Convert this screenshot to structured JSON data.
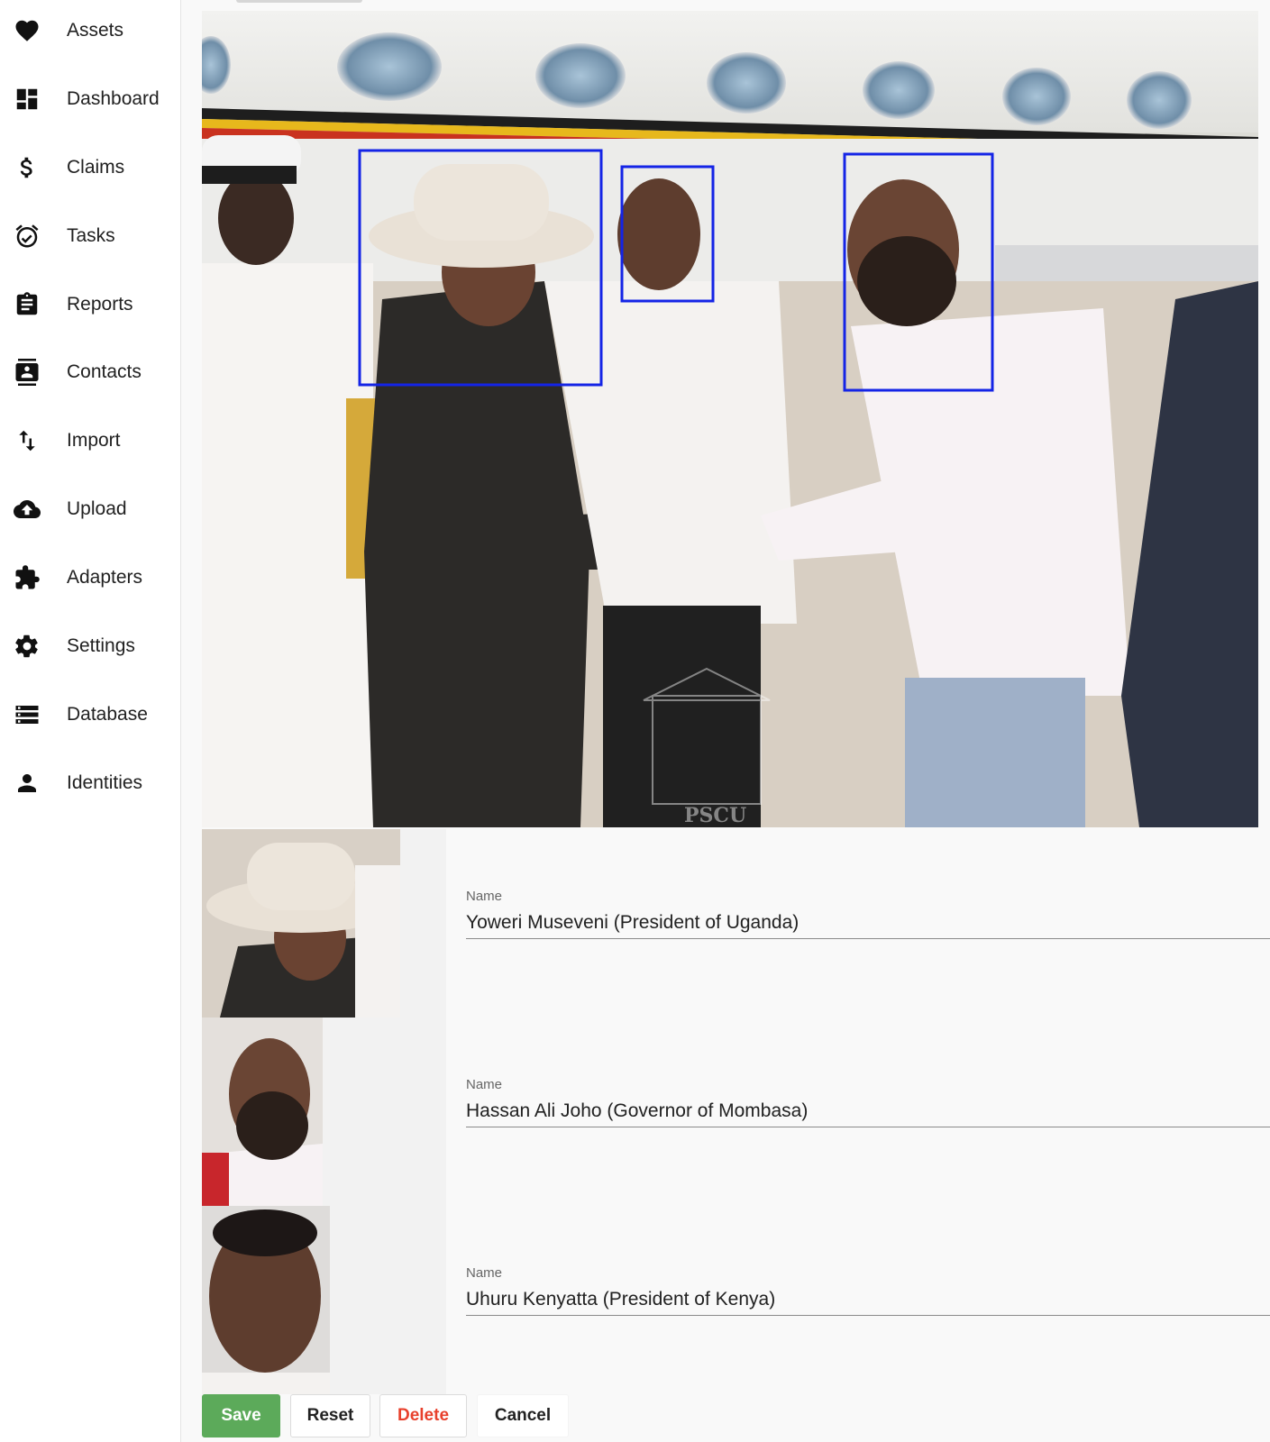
{
  "sidebar": {
    "items": [
      {
        "label": "Assets",
        "icon": "heart-icon"
      },
      {
        "label": "Dashboard",
        "icon": "dashboard-icon"
      },
      {
        "label": "Claims",
        "icon": "dollar-icon"
      },
      {
        "label": "Tasks",
        "icon": "alarm-clock-icon"
      },
      {
        "label": "Reports",
        "icon": "clipboard-icon"
      },
      {
        "label": "Contacts",
        "icon": "contact-card-icon"
      },
      {
        "label": "Import",
        "icon": "swap-vertical-icon"
      },
      {
        "label": "Upload",
        "icon": "cloud-upload-icon"
      },
      {
        "label": "Adapters",
        "icon": "puzzle-icon"
      },
      {
        "label": "Settings",
        "icon": "gear-icon"
      },
      {
        "label": "Database",
        "icon": "list-icon"
      },
      {
        "label": "Identities",
        "icon": "person-icon"
      }
    ]
  },
  "photo": {
    "watermark": "PSCU",
    "box_color": "#1424e6"
  },
  "faces": [
    {
      "field_label": "Name",
      "value": "Yoweri Museveni (President of Uganda)"
    },
    {
      "field_label": "Name",
      "value": "Hassan Ali Joho (Governor of Mombasa)"
    },
    {
      "field_label": "Name",
      "value": "Uhuru Kenyatta (President of Kenya)"
    }
  ],
  "actions": {
    "save": "Save",
    "reset": "Reset",
    "delete": "Delete",
    "cancel": "Cancel"
  },
  "colors": {
    "save": "#5caa5a",
    "delete_text": "#e8402c"
  }
}
